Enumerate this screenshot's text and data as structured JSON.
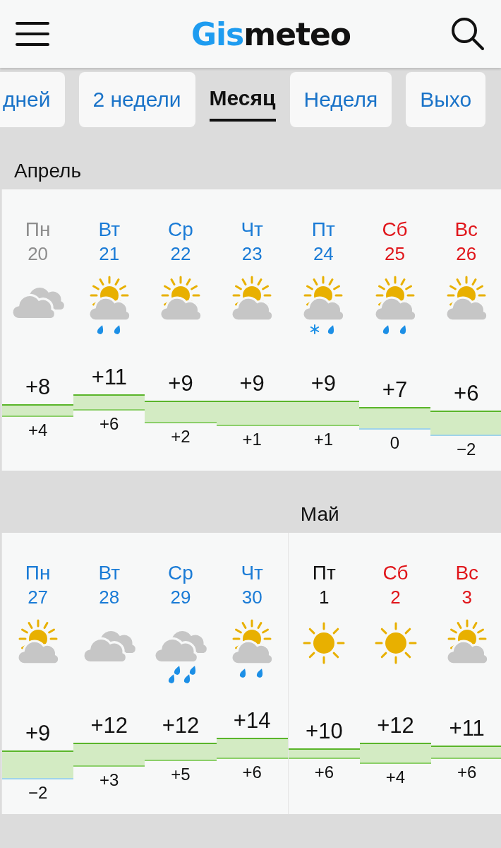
{
  "header": {
    "logo": {
      "accent": "Gis",
      "rest": "meteo"
    }
  },
  "tabs": [
    {
      "label": "дней",
      "selected": false
    },
    {
      "label": "2 недели",
      "selected": false
    },
    {
      "label": "Месяц",
      "selected": true
    },
    {
      "label": "Неделя",
      "selected": false
    },
    {
      "label": "Выхо",
      "selected": false
    }
  ],
  "weeks": [
    {
      "cards": [
        {
          "month": "Апрель",
          "days": [
            {
              "name": "Пн",
              "date": "20",
              "kind": "past",
              "weather": {
                "kind": "clouds"
              },
              "max": "+8",
              "min": "+4"
            },
            {
              "name": "Вт",
              "date": "21",
              "kind": "weekday",
              "weather": {
                "kind": "suncloudrain"
              },
              "max": "+11",
              "min": "+6"
            },
            {
              "name": "Ср",
              "date": "22",
              "kind": "weekday",
              "weather": {
                "kind": "suncloud"
              },
              "max": "+9",
              "min": "+2"
            },
            {
              "name": "Чт",
              "date": "23",
              "kind": "weekday",
              "weather": {
                "kind": "suncloud"
              },
              "max": "+9",
              "min": "+1"
            },
            {
              "name": "Пт",
              "date": "24",
              "kind": "weekday",
              "weather": {
                "kind": "suncloudsleet"
              },
              "max": "+9",
              "min": "+1"
            },
            {
              "name": "Сб",
              "date": "25",
              "kind": "weekend",
              "weather": {
                "kind": "suncloudrain"
              },
              "max": "+7",
              "min": "0"
            },
            {
              "name": "Вс",
              "date": "26",
              "kind": "weekend",
              "weather": {
                "kind": "suncloud"
              },
              "max": "+6",
              "min": "−2"
            }
          ]
        }
      ]
    },
    {
      "cards": [
        {
          "days": [
            {
              "name": "Пн",
              "date": "27",
              "kind": "weekday",
              "weather": {
                "kind": "suncloud"
              },
              "max": "+9",
              "min": "−2"
            },
            {
              "name": "Вт",
              "date": "28",
              "kind": "weekday",
              "weather": {
                "kind": "clouds"
              },
              "max": "+12",
              "min": "+3"
            },
            {
              "name": "Ср",
              "date": "29",
              "kind": "weekday",
              "weather": {
                "kind": "cloudsrain"
              },
              "max": "+12",
              "min": "+5"
            },
            {
              "name": "Чт",
              "date": "30",
              "kind": "weekday",
              "weather": {
                "kind": "suncloudrain"
              },
              "max": "+14",
              "min": "+6"
            }
          ]
        },
        {
          "month": "Май",
          "days": [
            {
              "name": "Пт",
              "date": "1",
              "kind": "today",
              "weather": {
                "kind": "sun"
              },
              "max": "+10",
              "min": "+6"
            },
            {
              "name": "Сб",
              "date": "2",
              "kind": "weekend",
              "weather": {
                "kind": "sun"
              },
              "max": "+12",
              "min": "+4"
            },
            {
              "name": "Вс",
              "date": "3",
              "kind": "weekend",
              "weather": {
                "kind": "suncloud"
              },
              "max": "+11",
              "min": "+6"
            }
          ]
        }
      ]
    }
  ]
}
